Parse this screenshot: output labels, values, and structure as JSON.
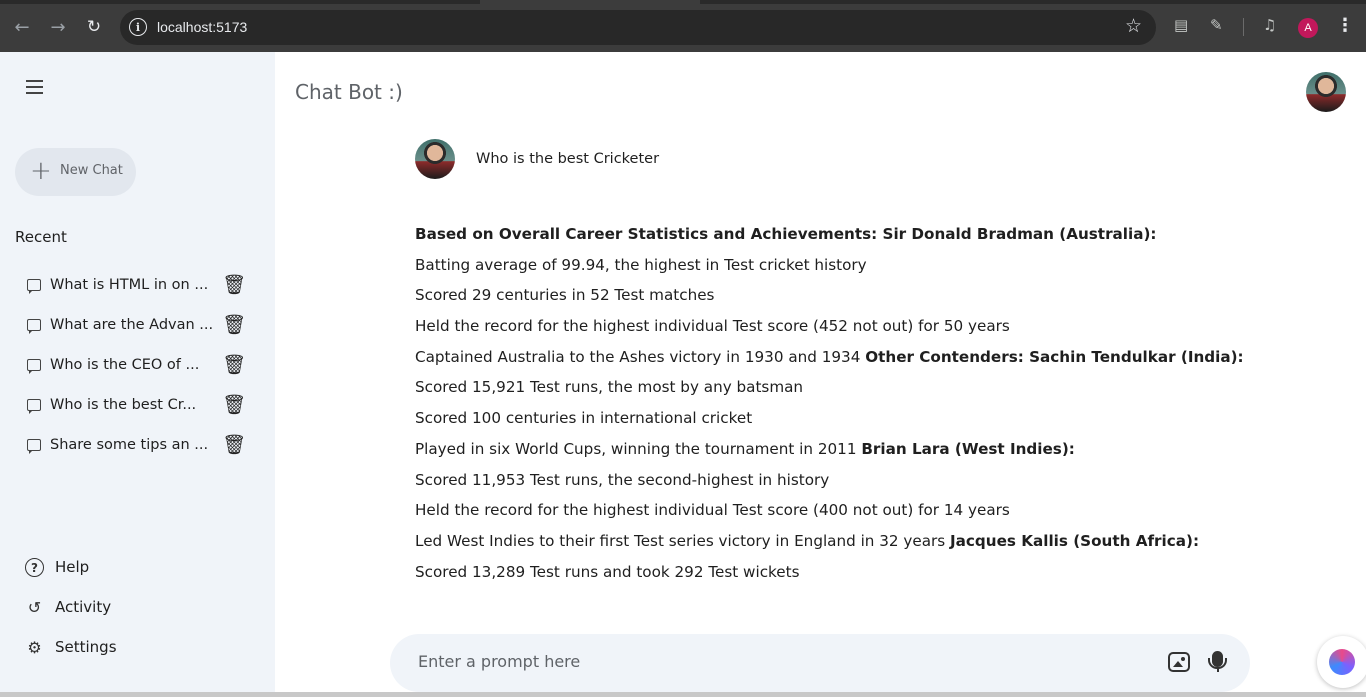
{
  "browser": {
    "url": "localhost:5173",
    "profile_initial": "A",
    "icons": [
      "back-arrow-icon",
      "forward-arrow-icon",
      "reload-icon",
      "site-info-icon",
      "star-icon",
      "cast-icon",
      "extensions-icon",
      "media-controls-icon",
      "more-vert-icon"
    ]
  },
  "sidebar": {
    "new_chat_label": "New Chat",
    "recent_heading": "Recent",
    "recent_items": [
      {
        "label": "What is HTML in on ..."
      },
      {
        "label": "What are the Advan ..."
      },
      {
        "label": "Who is the CEO of ..."
      },
      {
        "label": "Who is the best Cr..."
      },
      {
        "label": "Share some tips an ..."
      }
    ],
    "bottom_items": [
      {
        "label": "Help",
        "icon": "help-icon"
      },
      {
        "label": "Activity",
        "icon": "history-icon"
      },
      {
        "label": "Settings",
        "icon": "gear-icon"
      }
    ]
  },
  "main": {
    "title": "Chat Bot :)",
    "question": "Who is the best Cricketer",
    "answer_lines": [
      [
        {
          "t": "Based on Overall Career Statistics and Achievements: Sir Donald Bradman (Australia):",
          "b": true
        }
      ],
      [
        {
          "t": "Batting average of 99.94, the highest in Test cricket history",
          "b": false
        }
      ],
      [
        {
          "t": "Scored 29 centuries in 52 Test matches",
          "b": false
        }
      ],
      [
        {
          "t": "Held the record for the highest individual Test score (452 not out) for 50 years",
          "b": false
        }
      ],
      [
        {
          "t": "Captained Australia to the Ashes victory in 1930 and 1934 ",
          "b": false
        },
        {
          "t": "Other Contenders: Sachin Tendulkar (India):",
          "b": true
        }
      ],
      [
        {
          "t": "Scored 15,921 Test runs, the most by any batsman",
          "b": false
        }
      ],
      [
        {
          "t": "Scored 100 centuries in international cricket",
          "b": false
        }
      ],
      [
        {
          "t": "Played in six World Cups, winning the tournament in 2011 ",
          "b": false
        },
        {
          "t": "Brian Lara (West Indies):",
          "b": true
        }
      ],
      [
        {
          "t": "Scored 11,953 Test runs, the second-highest in history",
          "b": false
        }
      ],
      [
        {
          "t": "Held the record for the highest individual Test score (400 not out) for 14 years",
          "b": false
        }
      ],
      [
        {
          "t": "Led West Indies to their first Test series victory in England in 32 years ",
          "b": false
        },
        {
          "t": "Jacques Kallis (South Africa):",
          "b": true
        }
      ],
      [
        {
          "t": "Scored 13,289 Test runs and took 292 Test wickets",
          "b": false
        }
      ]
    ]
  },
  "prompt": {
    "placeholder": "Enter a prompt here"
  }
}
